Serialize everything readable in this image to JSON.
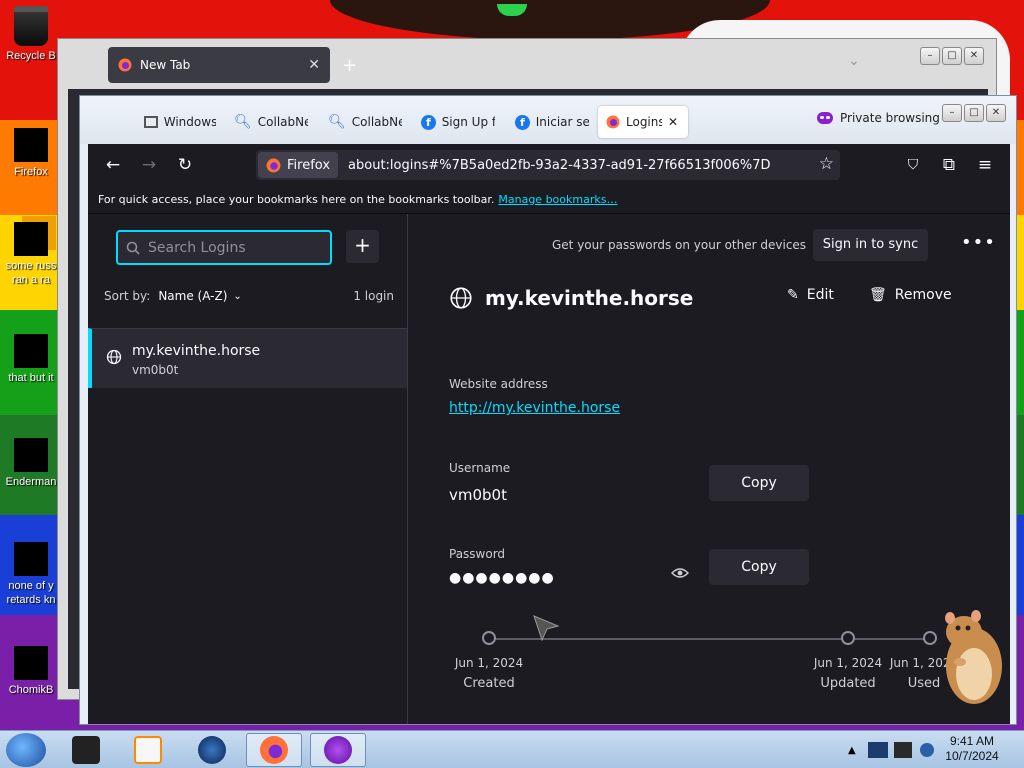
{
  "desktop": {
    "icons": [
      {
        "label": "Recycle B"
      },
      {
        "label": "Firefox"
      },
      {
        "label": "some russ"
      },
      {
        "label": "ran a ra"
      },
      {
        "label": "that but it"
      },
      {
        "label": "Enderman"
      },
      {
        "label": "none of y"
      },
      {
        "label": "retards kn"
      },
      {
        "label": "ChomikB"
      }
    ]
  },
  "back_window": {
    "tab_label": "New Tab",
    "new_tab_symbol": "+"
  },
  "window": {
    "tabs": [
      {
        "label": "Windows"
      },
      {
        "label": "CollabNe"
      },
      {
        "label": "CollabNe"
      },
      {
        "label": "Sign Up f"
      },
      {
        "label": "Iniciar se"
      },
      {
        "label": "Logins"
      }
    ],
    "private_label": "Private browsing"
  },
  "navbar": {
    "identity_label": "Firefox",
    "url": "about:logins#%7B5a0ed2fb-93a2-4337-ad91-27f66513f006%7D"
  },
  "bookmarks_bar": {
    "text": "For quick access, place your bookmarks here on the bookmarks toolbar.",
    "link": "Manage bookmarks…"
  },
  "sidebar": {
    "search_placeholder": "Search Logins",
    "add_symbol": "+",
    "sort_by": "Sort by:",
    "sort_value": "Name (A-Z)",
    "count": "1 login",
    "logins": [
      {
        "site": "my.kevinthe.horse",
        "username": "vm0b0t"
      }
    ]
  },
  "detail": {
    "sync_prompt": "Get your passwords on your other devices",
    "sync_button": "Sign in to sync",
    "more_symbol": "•••",
    "title": "my.kevinthe.horse",
    "edit_label": "Edit",
    "remove_label": "Remove",
    "website_label": "Website address",
    "website_value": "http://my.kevinthe.horse",
    "username_label": "Username",
    "username_value": "vm0b0t",
    "password_label": "Password",
    "password_value": "●●●●●●●●",
    "copy_label": "Copy",
    "timeline": [
      {
        "date": "Jun 1, 2024",
        "label": "Created"
      },
      {
        "date": "Jun 1, 2024",
        "label": "Updated"
      },
      {
        "date": "Jun 1, 2024",
        "label": "Used"
      }
    ]
  },
  "taskbar": {
    "time": "9:41 AM",
    "date": "10/7/2024"
  },
  "colors": {
    "accent": "#00ddff",
    "background": "#1c1b22",
    "panel": "#2b2a33"
  }
}
